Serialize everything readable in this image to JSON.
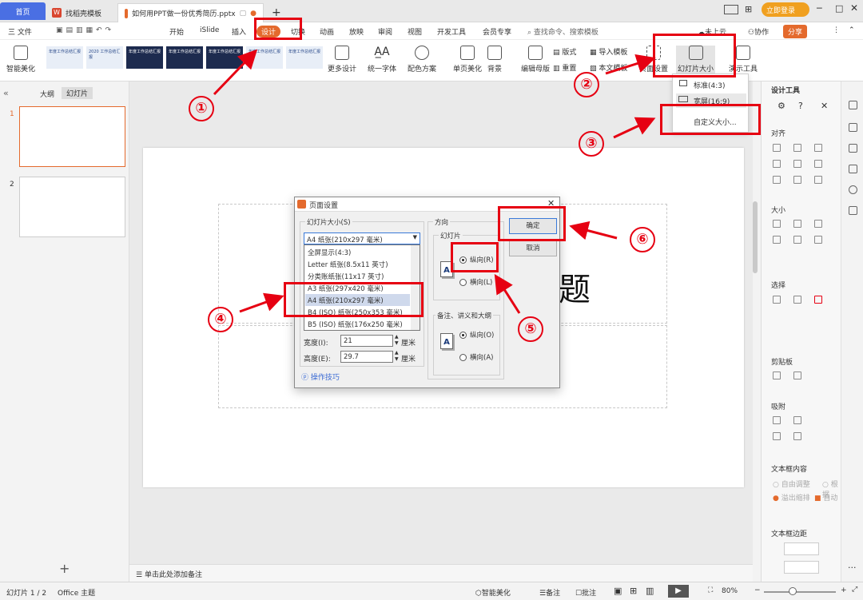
{
  "tabs": {
    "home": "首页",
    "template": "找稻壳模板",
    "doc": "如何用PPT做一份优秀简历.pptx"
  },
  "titlebar": {
    "login": "立即登录"
  },
  "menu": {
    "file": "三 文件",
    "items": [
      "开始",
      "iSlide",
      "插入",
      "设计",
      "切换",
      "动画",
      "放映",
      "审阅",
      "视图",
      "开发工具",
      "会员专享"
    ],
    "search": "查找命令、搜索模板",
    "cloud": "未上云",
    "collab": "协作",
    "share": "分享"
  },
  "ribbon": {
    "smart": "智能美化",
    "more_design": "更多设计",
    "unify_font": "统一字体",
    "color_scheme": "配色方案",
    "single_beautify": "单页美化",
    "background": "背景",
    "edit_master": "编辑母版",
    "format": "版式",
    "reset": "重置",
    "import_tpl": "导入模板",
    "this_tpl": "本文模板",
    "page_setup": "页面设置",
    "slide_size": "幻灯片大小",
    "present_tool": "演示工具",
    "thumbs": [
      "年度工作总结汇报",
      "2020 工作总结汇报",
      "年度工作总结汇报",
      "年度工作总结汇报",
      "年度工作总结汇报",
      "年度工作总结汇报",
      "年度工作总结汇报"
    ]
  },
  "slide_size_menu": {
    "standard": "标准(4:3)",
    "wide": "宽屏(16:9)",
    "custom": "自定义大小..."
  },
  "left": {
    "outline": "大纲",
    "slides": "幻灯片",
    "n1": "1",
    "n2": "2"
  },
  "slide": {
    "title_char": "题"
  },
  "notes": "单击此处添加备注",
  "status": {
    "slide_no": "幻灯片 1 / 2",
    "theme": "Office 主题",
    "smart": "智能美化",
    "notes": "备注",
    "comment": "批注",
    "zoom": "80%"
  },
  "panel": {
    "title": "设计工具",
    "align": "对齐",
    "size": "大小",
    "select": "选择",
    "clipboard": "剪贴板",
    "snap": "吸附",
    "textbox": "文本框内容",
    "auto_adj": "自由调整",
    "wrap": "溢出缩排",
    "auto": "自动",
    "margin": "文本框边距",
    "by_shape": "根据"
  },
  "dialog": {
    "title": "页面设置",
    "size_label": "幻灯片大小(S)",
    "size_value": "A4 纸张(210x297 毫米)",
    "options": [
      "全屏显示(4:3)",
      "Letter 纸张(8.5x11 英寸)",
      "分类账纸张(11x17 英寸)",
      "A3 纸张(297x420 毫米)",
      "A4 纸张(210x297 毫米)",
      "B4 (ISO) 纸张(250x353 毫米)",
      "B5 (ISO) 纸张(176x250 毫米)"
    ],
    "width_label": "宽度(I):",
    "width_value": "21",
    "height_label": "高度(E):",
    "height_value": "29.7",
    "unit": "厘米",
    "tips": "操作技巧",
    "orientation": "方向",
    "slide_group": "幻灯片",
    "portrait": "纵向(R)",
    "landscape": "横向(L)",
    "notes_group": "备注、讲义和大纲",
    "portrait2": "纵向(O)",
    "landscape2": "横向(A)",
    "ok": "确定",
    "cancel": "取消"
  },
  "annotations": [
    "①",
    "②",
    "③",
    "④",
    "⑤",
    "⑥"
  ],
  "colors": {
    "accent_red": "#e60012",
    "brand_orange": "#e46a2d",
    "home_blue": "#4a6fe3"
  }
}
